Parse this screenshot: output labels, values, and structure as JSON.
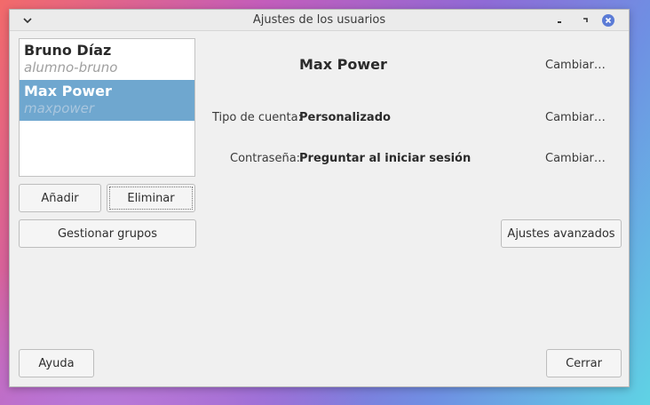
{
  "window": {
    "title": "Ajustes de los usuarios"
  },
  "users": [
    {
      "name": "Bruno Díaz",
      "login": "alumno-bruno",
      "selected": false
    },
    {
      "name": "Max Power",
      "login": "maxpower",
      "selected": true
    }
  ],
  "buttons": {
    "add": "Añadir",
    "remove": "Eliminar",
    "groups": "Gestionar grupos",
    "help": "Ayuda",
    "close": "Cerrar",
    "advanced": "Ajustes avanzados"
  },
  "details": {
    "name": "Max Power",
    "name_change": "Cambiar…",
    "account_type_label": "Tipo de cuenta:",
    "account_type_value": "Personalizado",
    "account_type_change": "Cambiar…",
    "password_label": "Contraseña:",
    "password_value": "Preguntar al iniciar sesión",
    "password_change": "Cambiar…"
  },
  "colors": {
    "selection": "#6fa7cf",
    "close_button": "#5b7bd6"
  },
  "icons": {
    "window_menu": "chevron-down-icon",
    "minimize": "minimize-icon",
    "maximize": "maximize-icon",
    "close": "close-icon"
  }
}
